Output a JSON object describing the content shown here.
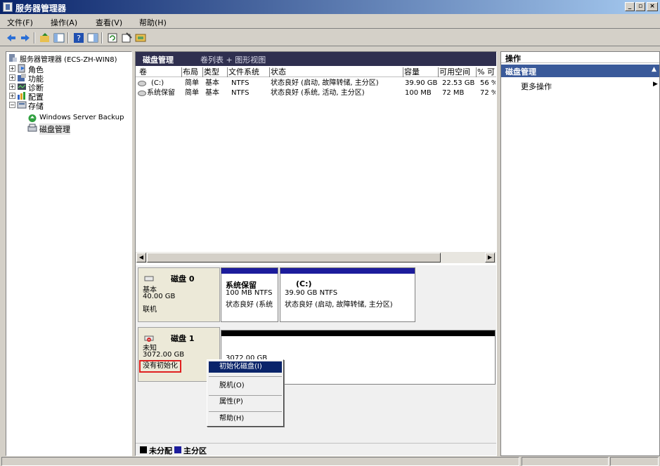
{
  "window": {
    "title": "服务器管理器",
    "min_label": "_",
    "max_label": "▫",
    "close_label": "×"
  },
  "menu": [
    {
      "label": "文件(F)"
    },
    {
      "label": "操作(A)"
    },
    {
      "label": "查看(V)"
    },
    {
      "label": "帮助(H)"
    }
  ],
  "tree": {
    "root": "服务器管理器 (ECS-ZH-WIN8)",
    "items": [
      "角色",
      "功能",
      "诊断",
      "配置",
      "存储"
    ],
    "storage_children": [
      "Windows Server Backup",
      "磁盘管理"
    ]
  },
  "center": {
    "title": "磁盘管理",
    "view": "卷列表 + 图形视图",
    "columns": [
      "卷",
      "布局",
      "类型",
      "文件系统",
      "状态",
      "容量",
      "可用空间",
      "% 可"
    ],
    "rows": [
      {
        "vol": "(C:)",
        "layout": "简单",
        "type": "基本",
        "fs": "NTFS",
        "status": "状态良好 (启动, 故障转储, 主分区)",
        "cap": "39.90 GB",
        "free": "22.53 GB",
        "pct": "56 %"
      },
      {
        "vol": "系统保留",
        "layout": "简单",
        "type": "基本",
        "fs": "NTFS",
        "status": "状态良好 (系统, 活动, 主分区)",
        "cap": "100 MB",
        "free": "72 MB",
        "pct": "72 %"
      }
    ]
  },
  "disks": {
    "disk0": {
      "name": "磁盘 0",
      "type": "基本",
      "size": "40.00 GB",
      "state": "联机",
      "p1": {
        "title": "系统保留",
        "line1": "100 MB NTFS",
        "line2": "状态良好 (系统"
      },
      "p2": {
        "title": "(C:)",
        "line1": "39.90 GB NTFS",
        "line2": "状态良好 (启动, 故障转储, 主分区)"
      }
    },
    "disk1": {
      "name": "磁盘 1",
      "type": "未知",
      "size": "3072.00 GB",
      "state": "没有初始化",
      "p1": {
        "line1": "3072.00 GB"
      }
    }
  },
  "legend": {
    "unallocated": "未分配",
    "primary": "主分区"
  },
  "context_menu": [
    "初始化磁盘(I)",
    "脱机(O)",
    "属性(P)",
    "帮助(H)"
  ],
  "actions": {
    "title": "操作",
    "section": "磁盘管理",
    "more": "更多操作"
  },
  "colors": {
    "titlebar": "#0a246a",
    "header": "#2f2f4f",
    "primary": "#1c1c9c",
    "unallocated": "#000000",
    "select": "#0a246a",
    "highlight_box": "#e02020"
  }
}
